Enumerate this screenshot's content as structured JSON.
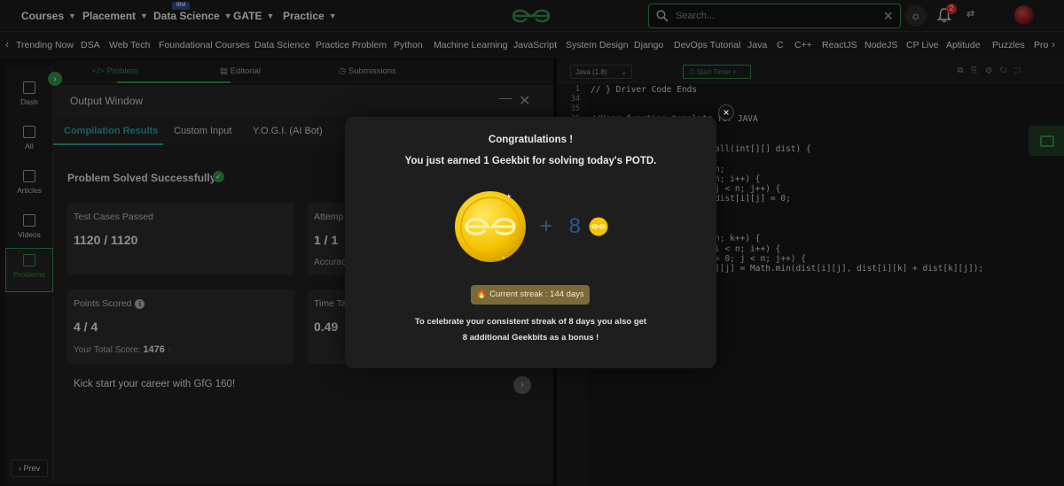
{
  "topnav": {
    "menus": [
      {
        "label": "Courses"
      },
      {
        "label": "Placement"
      },
      {
        "label": "Data Science"
      },
      {
        "label": "GATE"
      },
      {
        "label": "Practice"
      }
    ],
    "ibm_badge": "IBM",
    "search_placeholder": "Search...",
    "notifications_count": "2",
    "icons": [
      "search-icon",
      "sun-icon",
      "bell-icon",
      "language-icon",
      "avatar"
    ]
  },
  "subnav": {
    "items": [
      "Trending Now",
      "DSA",
      "Web Tech",
      "Foundational Courses",
      "Data Science",
      "Practice Problem",
      "Python",
      "Machine Learning",
      "JavaScript",
      "System Design",
      "Django",
      "DevOps Tutorial",
      "Java",
      "C",
      "C++",
      "ReactJS",
      "NodeJS",
      "CP Live",
      "Aptitude",
      "Puzzles",
      "Pro"
    ]
  },
  "rail": {
    "items": [
      {
        "label": "Dash"
      },
      {
        "label": "All"
      },
      {
        "label": "Articles"
      },
      {
        "label": "Videos"
      },
      {
        "label": "Problems"
      }
    ],
    "prev_label": "Prev"
  },
  "panel_tabs": {
    "problem": "Problem",
    "editorial": "Editorial",
    "submissions": "Submissions"
  },
  "output": {
    "title": "Output Window",
    "tabs": [
      "Compilation Results",
      "Custom Input",
      "Y.O.G.I. (AI Bot)"
    ],
    "solved_text": "Problem Solved Successfully",
    "cards": {
      "tests_label": "Test Cases Passed",
      "tests_value": "1120 / 1120",
      "attempts_label": "Attemp",
      "attempts_value": "1 / 1",
      "accuracy_label": "Accurac",
      "points_label": "Points Scored",
      "points_value": "4 / 4",
      "total_label": "Your Total Score:",
      "total_value": "1476",
      "time_label": "Time Ta",
      "time_value": "0.49"
    },
    "kick_text": "Kick start your career with GfG 160!"
  },
  "editor": {
    "language": "Java (1.8)",
    "timer_label": "Start Timer",
    "line_numbers": [
      "1",
      "34",
      "35",
      "36"
    ],
    "code_lines": [
      {
        "text": "// } Driver Code Ends",
        "cls": "cmt"
      },
      {
        "text": "//User function template for JAVA",
        "cls": "cmt"
      },
      {
        "text": "all(int[][] dist) {",
        "cls": ""
      },
      {
        "text": "n;",
        "cls": ""
      },
      {
        "text": "n; i++) {",
        "cls": ""
      },
      {
        "text": "j < n; j++) {",
        "cls": ""
      },
      {
        "text": "dist[i][j] = 0;",
        "cls": ""
      },
      {
        "text": "n; k++) {",
        "cls": ""
      },
      {
        "text": "i < n; i++) {",
        "cls": ""
      },
      {
        "text": "= 0; j < n; j++) {",
        "cls": ""
      },
      {
        "text": "][j] = Math.min(dist[i][j], dist[i][k] + dist[k][j]);",
        "cls": ""
      }
    ]
  },
  "modal": {
    "title": "Congratulations !",
    "subtitle": "You just earned 1 Geekbit for solving today's POTD.",
    "plus_text": "+ 8",
    "streak_text": "Current streak : 144 days",
    "body_line1": "To celebrate your consistent streak of 8 days you also get",
    "body_line2": "8 additional Geekbits as a bonus !",
    "close": "×"
  },
  "colors": {
    "brand_green": "#2f8d46",
    "coin_gold": "#f5c400",
    "streak_bg": "#7a6a3a",
    "tab_teal": "#2a9d8f"
  }
}
